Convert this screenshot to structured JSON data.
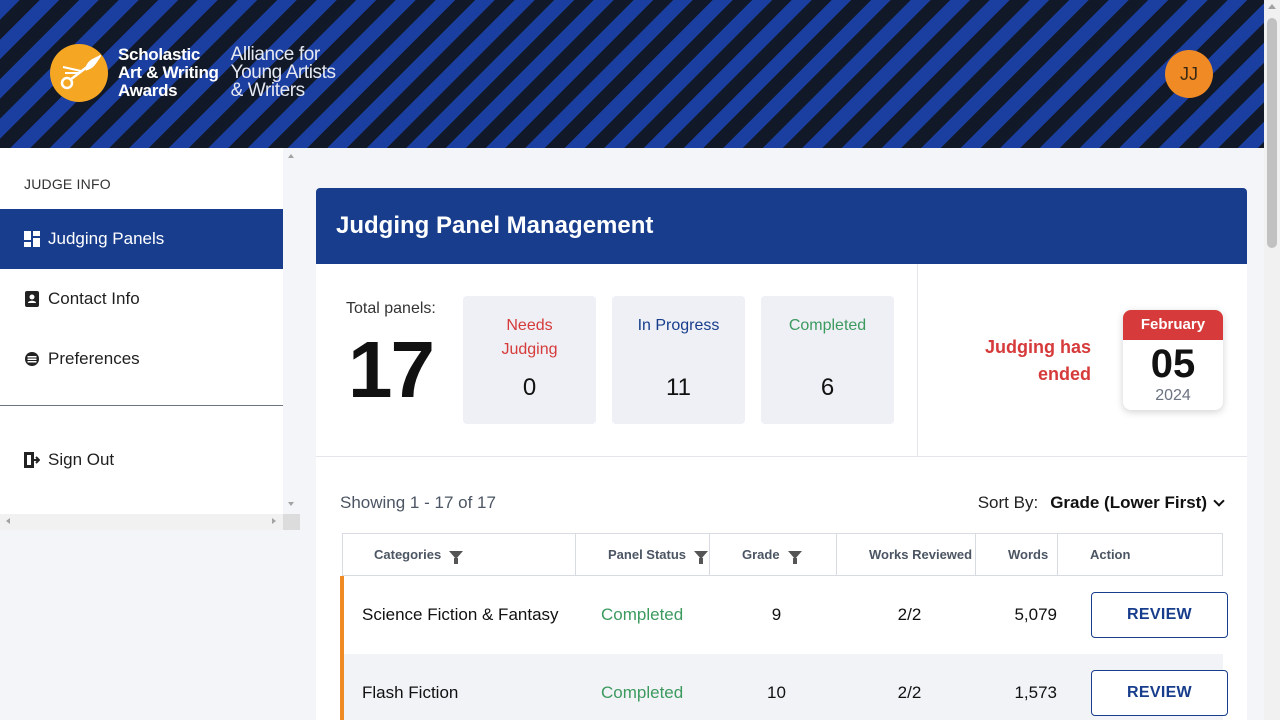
{
  "header": {
    "logo_line1": "Scholastic",
    "logo_line2": "Art & Writing",
    "logo_line3": "Awards",
    "logo_sub1": "Alliance for",
    "logo_sub2": "Young Artists",
    "logo_sub3": "& Writers",
    "avatar_initials": "JJ",
    "stripe_colors": [
      "#1b3fa0",
      "#111827"
    ]
  },
  "sidebar": {
    "heading": "JUDGE INFO",
    "items": [
      {
        "label": "Judging Panels",
        "icon": "dashboard-grid-icon",
        "active": true
      },
      {
        "label": "Contact Info",
        "icon": "contact-card-icon",
        "active": false
      },
      {
        "label": "Preferences",
        "icon": "settings-icon",
        "active": false
      }
    ],
    "sign_out": {
      "label": "Sign Out",
      "icon": "sign-out-icon"
    }
  },
  "main": {
    "title": "Judging Panel Management",
    "total_label": "Total panels:",
    "total_value": "17",
    "stats": [
      {
        "label": "Needs Judging",
        "value": "0",
        "color": "#d63a3a"
      },
      {
        "label": "In Progress",
        "value": "11",
        "color": "#173d8c"
      },
      {
        "label": "Completed",
        "value": "6",
        "color": "#3d9a5f"
      }
    ],
    "judging_status": "Judging has ended",
    "calendar": {
      "month": "February",
      "day": "05",
      "year": "2024"
    },
    "showing": "Showing 1 - 17 of 17",
    "sort_label": "Sort By:",
    "sort_value": "Grade (Lower First)",
    "columns": [
      "Categories",
      "Panel Status",
      "Grade",
      "Works Reviewed",
      "Words",
      "Action"
    ],
    "rows": [
      {
        "category": "Science Fiction & Fantasy",
        "status": "Completed",
        "grade": "9",
        "works_reviewed": "2/2",
        "words": "5,079",
        "action": "REVIEW"
      },
      {
        "category": "Flash Fiction",
        "status": "Completed",
        "grade": "10",
        "works_reviewed": "2/2",
        "words": "1,573",
        "action": "REVIEW"
      }
    ]
  },
  "colors": {
    "primary": "#173d8c",
    "accent": "#f08a24",
    "success": "#3d9a5f",
    "danger": "#d63a3a"
  }
}
